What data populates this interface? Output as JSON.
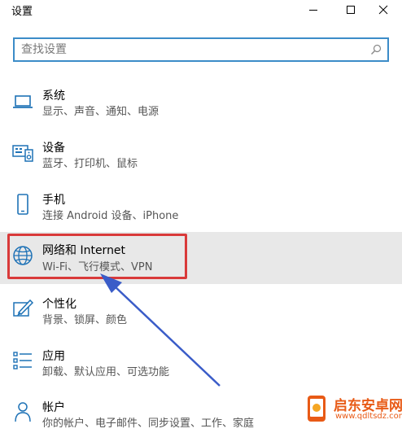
{
  "window": {
    "title": "设置",
    "minimize_icon": "minimize-icon",
    "maximize_icon": "maximize-icon",
    "close_icon": "close-icon"
  },
  "search": {
    "placeholder": "查找设置",
    "icon": "search-icon",
    "accent_color": "#3c8cc8"
  },
  "items": [
    {
      "name": "系统",
      "desc": "显示、声音、通知、电源",
      "icon": "laptop-icon"
    },
    {
      "name": "设备",
      "desc": "蓝牙、打印机、鼠标",
      "icon": "keyboard-speaker-icon"
    },
    {
      "name": "手机",
      "desc": "连接 Android 设备、iPhone",
      "icon": "phone-icon"
    },
    {
      "name": "网络和 Internet",
      "desc": "Wi-Fi、飞行模式、VPN",
      "icon": "globe-icon",
      "highlighted": true
    },
    {
      "name": "个性化",
      "desc": "背景、锁屏、颜色",
      "icon": "paint-brush-icon"
    },
    {
      "name": "应用",
      "desc": "卸载、默认应用、可选功能",
      "icon": "apps-list-icon"
    },
    {
      "name": "帐户",
      "desc": "你的帐户、电子邮件、同步设置、工作、家庭",
      "icon": "person-icon"
    }
  ],
  "annotation": {
    "box_color": "#d93a3a",
    "arrow_color": "#3a5cc8"
  },
  "watermark": {
    "line1": "启东安卓网",
    "line2": "www.qdltsdz.com",
    "color": "#e85a16",
    "icon": "phone-logo-icon"
  }
}
